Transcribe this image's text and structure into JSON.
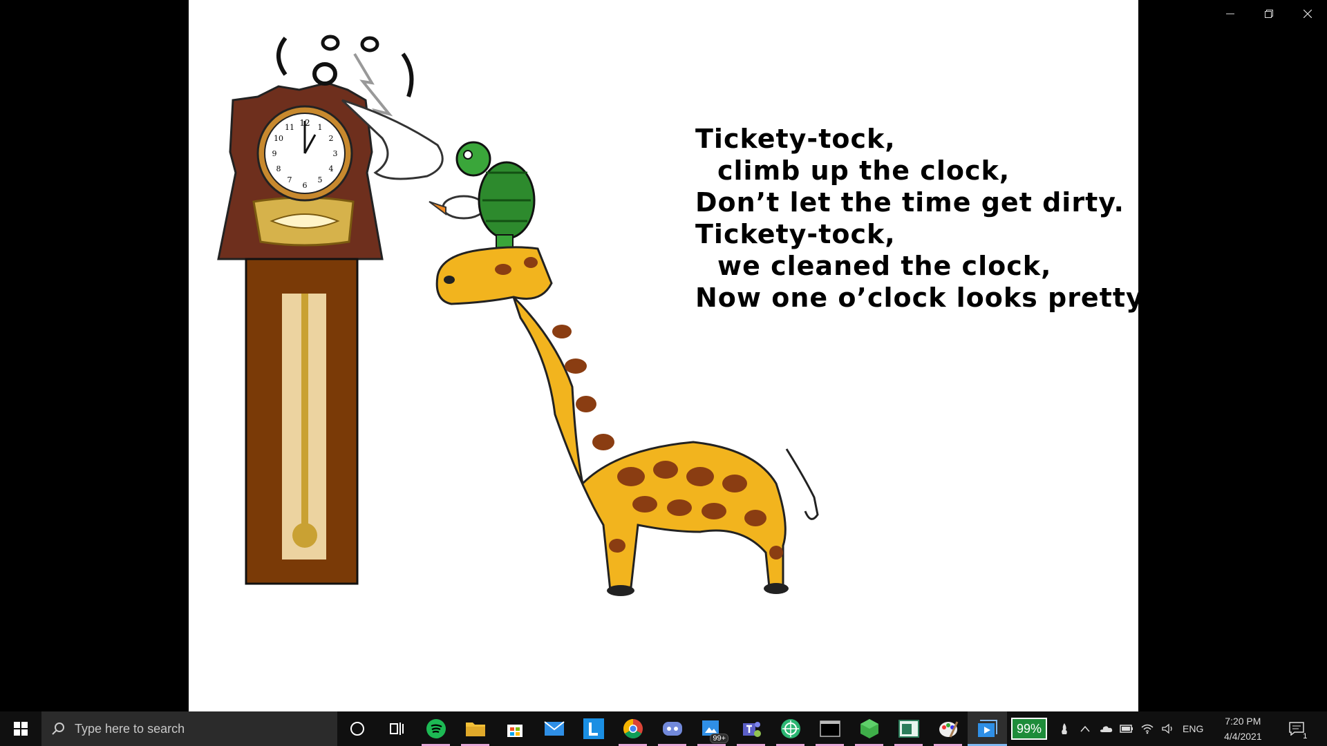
{
  "window": {
    "controls": [
      "minimize-icon",
      "restore-icon",
      "close-icon"
    ]
  },
  "slide": {
    "poem": [
      "Tickety-tock,",
      "climb up the clock,",
      "Don’t let the time get dirty.",
      "Tickety-tock,",
      "we cleaned the clock,",
      "Now one o’clock looks pretty."
    ],
    "clock_numerals": [
      "12",
      "1",
      "2",
      "3",
      "4",
      "5",
      "6",
      "7",
      "8",
      "9",
      "10",
      "11"
    ],
    "illustration": [
      "grandfather-clock",
      "giraffe",
      "turtle",
      "bird"
    ]
  },
  "taskbar": {
    "search_placeholder": "Type here to search",
    "apps": [
      {
        "icon": "cortana-icon"
      },
      {
        "icon": "task-view-icon"
      },
      {
        "icon": "spotify-icon",
        "color": "#1db954"
      },
      {
        "icon": "file-explorer-icon",
        "color": "#f2c037"
      },
      {
        "icon": "microsoft-store-icon"
      },
      {
        "icon": "mail-icon",
        "color": "#2f8fe6"
      },
      {
        "icon": "l-app-icon",
        "color": "#1a8fe3"
      },
      {
        "icon": "chrome-icon"
      },
      {
        "icon": "discord-icon",
        "color": "#7289da"
      },
      {
        "icon": "photos-icon",
        "badge": "99+"
      },
      {
        "icon": "teams-icon",
        "color": "#5b5fc7"
      },
      {
        "icon": "vpn-app-icon",
        "color": "#2bb673"
      },
      {
        "icon": "terminal-icon"
      },
      {
        "icon": "green-cube-icon",
        "color": "#3fae49"
      },
      {
        "icon": "window-app-icon"
      },
      {
        "icon": "paint-icon"
      },
      {
        "icon": "media-player-icon"
      }
    ],
    "battery_percent": "99%",
    "language": "ENG",
    "time": "7:20 PM",
    "date": "4/4/2021",
    "notification_count": "1"
  }
}
